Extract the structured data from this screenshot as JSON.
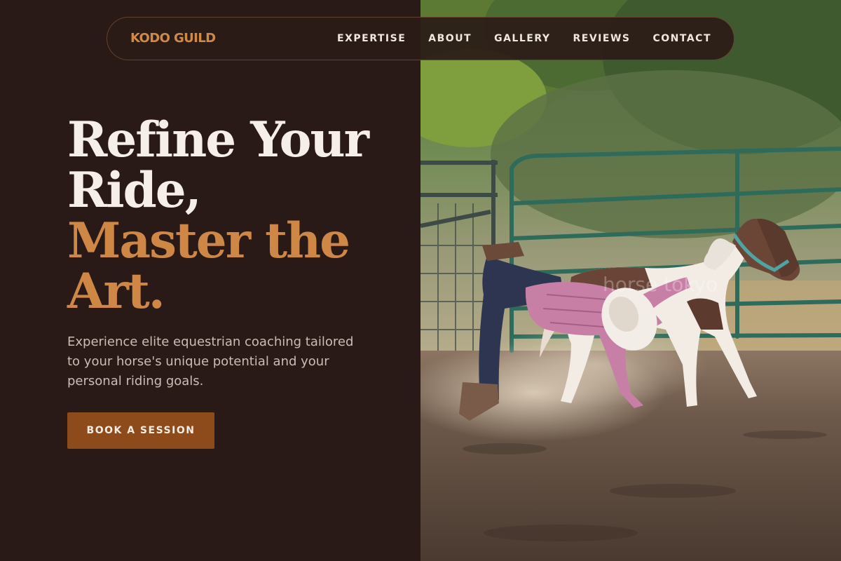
{
  "brand": {
    "name": "KODO GUILD"
  },
  "nav": {
    "links": [
      "EXPERTISE",
      "ABOUT",
      "GALLERY",
      "REVIEWS",
      "CONTACT"
    ]
  },
  "hero": {
    "headline_white": [
      "Refine Your",
      "Ride,"
    ],
    "headline_orange": [
      "Master the",
      "Art."
    ],
    "subtext": "Experience elite equestrian coaching tailored to your horse's unique potential and your personal riding goals.",
    "cta_label": "BOOK A SESSION"
  },
  "photo": {
    "subject": "cowgirl lunging beside a running pinto pony in a dusty arena",
    "icon": "hero-photo"
  },
  "colors": {
    "background": "#2a1a17",
    "accent": "#cf8745",
    "button": "#8d4a1b",
    "text_light": "#f6efe9",
    "text_muted": "#cbbcb4"
  }
}
